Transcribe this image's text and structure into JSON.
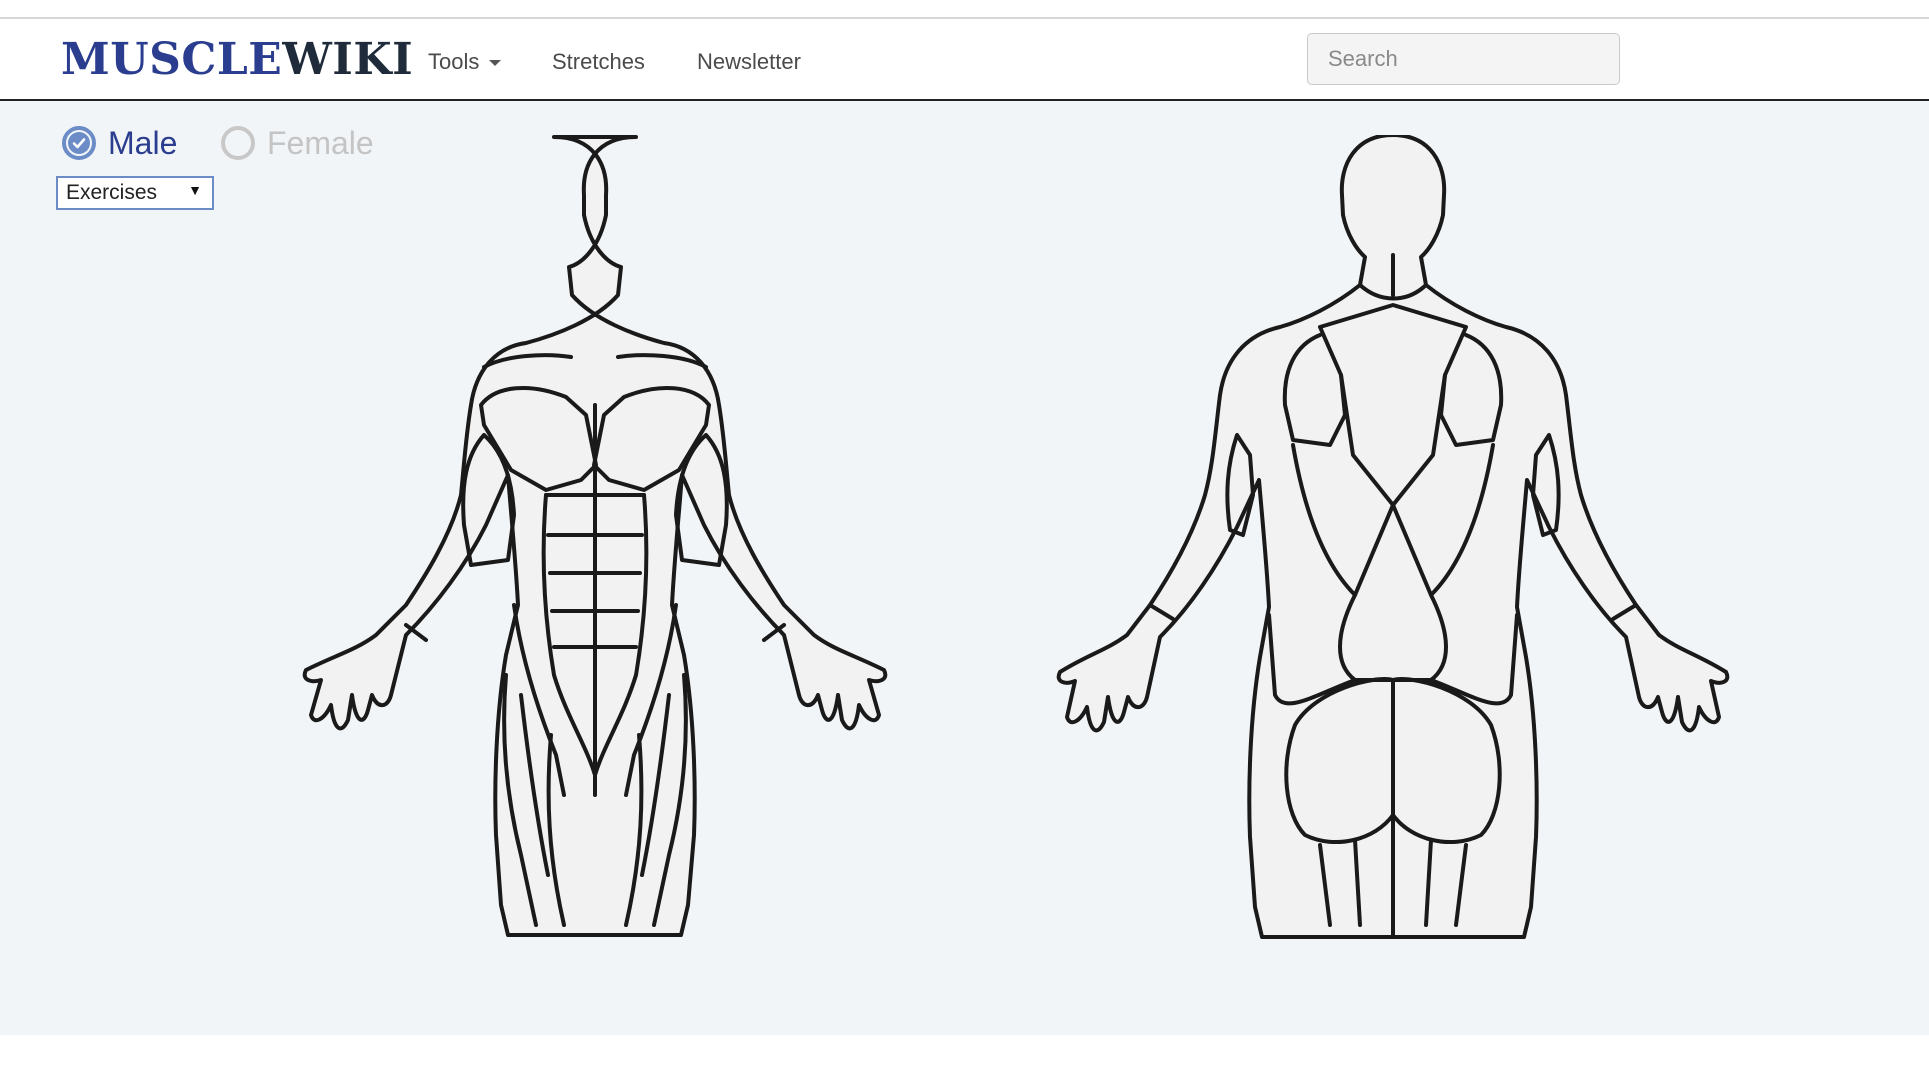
{
  "header": {
    "logo_part1": "MUSCLE",
    "logo_part2": "WIKI",
    "nav": [
      {
        "label": "Tools",
        "has_dropdown": true
      },
      {
        "label": "Stretches"
      },
      {
        "label": "Newsletter"
      }
    ],
    "search": {
      "placeholder": "Search",
      "value": ""
    }
  },
  "controls": {
    "gender_options": [
      {
        "label": "Male",
        "selected": true
      },
      {
        "label": "Female",
        "selected": false
      }
    ],
    "mode_select": {
      "selected": "Exercises",
      "arrow": "▼"
    }
  },
  "icons": {
    "selected_radio": "check-circle-icon",
    "unselected_radio": "empty-circle-icon",
    "dropdown": "caret-down-icon"
  },
  "colors": {
    "brand_blue": "#2a3d8f",
    "accent_blue": "#6b8cc7",
    "content_bg": "#f2f5f8",
    "muted_gray": "#c4c4c4"
  }
}
